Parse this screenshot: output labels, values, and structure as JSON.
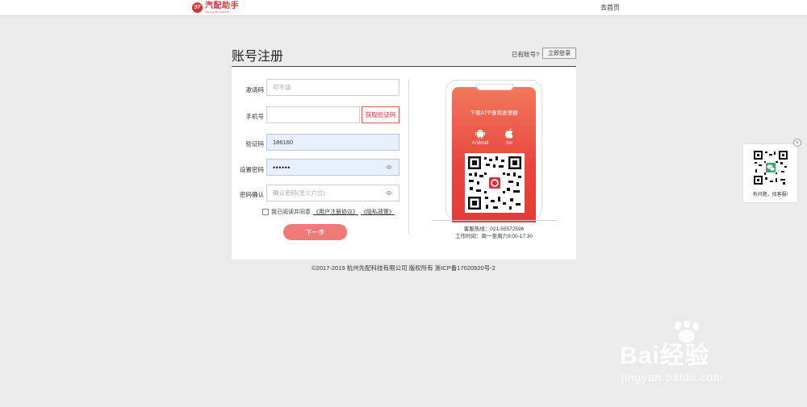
{
  "header": {
    "logo_title": "汽配助手",
    "logo_sub": "WE AUTO PARTS",
    "logo_mark": "97",
    "home_link": "去首页"
  },
  "page": {
    "title": "账号注册",
    "have_account": "已有账号?",
    "login_button": "立即登录"
  },
  "form": {
    "invite": {
      "label": "邀请码",
      "placeholder": "可不填",
      "value": ""
    },
    "phone": {
      "label": "手机号",
      "value": ""
    },
    "get_code_button": "获取验证码",
    "code": {
      "label": "验证码",
      "value": "186160"
    },
    "password": {
      "label": "设置密码",
      "value": "••••••"
    },
    "confirm": {
      "label": "密码确认",
      "placeholder": "确认密码(至少六位)"
    },
    "agree_text": "我已阅读并同意",
    "agreement_link": "《用户注册协议》",
    "privacy_link": "《隐私政策》",
    "next_button": "下一步"
  },
  "app_promo": {
    "screen_title": "下载APP查询更便捷",
    "android_label": "Android",
    "ios_label": "ios",
    "hotline": "客服热线：021-55572596",
    "hours": "工作时间：周一至周六9:00-17:30"
  },
  "footer": {
    "text": "©2017-2019 杭州先配科技有限公司 版权所有 浙ICP备17020920号-2"
  },
  "float": {
    "text": "有问题，找客服!",
    "close": "×"
  },
  "watermark": {
    "main": "Bai经验",
    "sub": "jingyan.baidu.com"
  },
  "colors": {
    "brand_red": "#d9313a",
    "button_pink": "#ef7a78",
    "filled_field": "#e8f0fe"
  }
}
